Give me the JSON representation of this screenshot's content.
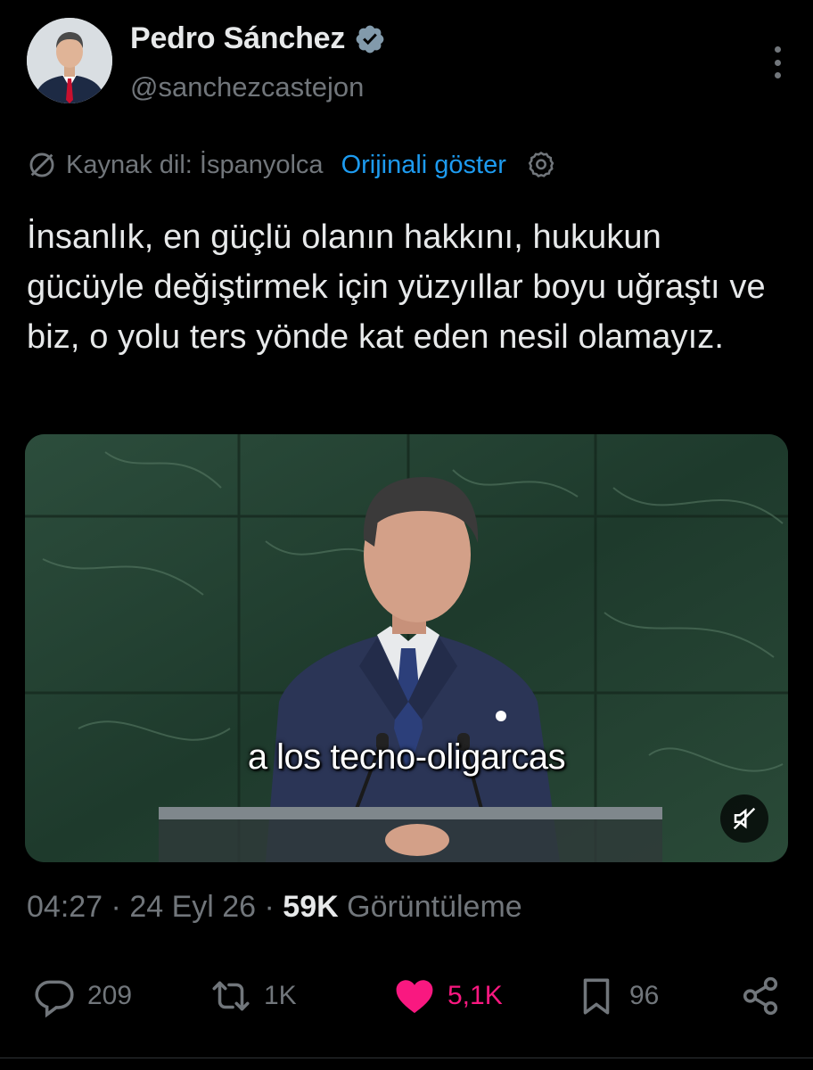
{
  "user": {
    "display_name": "Pedro Sánchez",
    "handle": "@sanchezcastejon",
    "verified": true,
    "verified_color": "#829aab",
    "avatar_icon": "avatar-photo"
  },
  "translation": {
    "source_label": "Kaynak dil: İspanyolca",
    "show_original": "Orijinali göster",
    "link_color": "#1d9bf0"
  },
  "tweet": {
    "text": "İnsanlık, en güçlü olanın hakkını, hukukun gücüyle değiştirmek için yüzyıllar boyu uğraştı ve biz, o yolu ters yönde kat eden nesil olamayız."
  },
  "media": {
    "type": "video",
    "subtitle": "a los tecno-oligarcas",
    "muted": true
  },
  "meta": {
    "time": "04:27",
    "separator": " · ",
    "date": "24 Eyl 26",
    "views_count": "59K",
    "views_label": "Görüntüleme"
  },
  "actions": {
    "replies": "209",
    "reposts": "1K",
    "likes": "5,1K",
    "bookmarks": "96",
    "liked": true,
    "like_color": "#f91880"
  }
}
